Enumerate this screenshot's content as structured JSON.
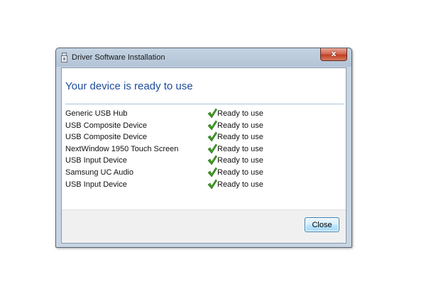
{
  "window": {
    "title": "Driver Software Installation",
    "close_glyph": "x",
    "title_icon": "usb-device-icon"
  },
  "main": {
    "heading": "Your device is ready to use",
    "devices": [
      {
        "name": "Generic USB Hub",
        "status": "Ready to use"
      },
      {
        "name": "USB Composite Device",
        "status": "Ready to use"
      },
      {
        "name": "USB Composite Device",
        "status": "Ready to use"
      },
      {
        "name": "NextWindow 1950 Touch Screen",
        "status": "Ready to use"
      },
      {
        "name": "USB Input Device",
        "status": "Ready to use"
      },
      {
        "name": "Samsung UC Audio",
        "status": "Ready to use"
      },
      {
        "name": "USB Input Device",
        "status": "Ready to use"
      }
    ],
    "status_icon": "green-checkmark-icon"
  },
  "footer": {
    "close_label": "Close"
  },
  "colors": {
    "heading": "#1e4c9a",
    "check": "#3f9b23",
    "accent_border": "#3c7fb1"
  }
}
